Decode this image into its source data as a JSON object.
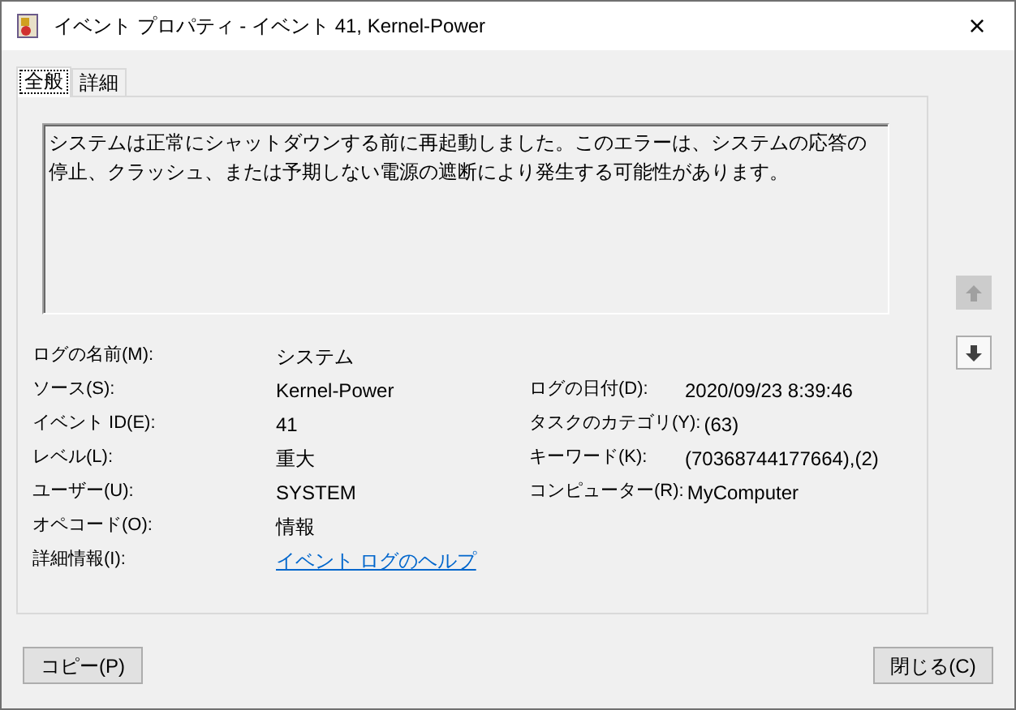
{
  "window": {
    "title": "イベント プロパティ - イベント 41, Kernel-Power",
    "close": "×"
  },
  "tabs": [
    {
      "label": "全般",
      "selected": true
    },
    {
      "label": "詳細",
      "selected": false
    }
  ],
  "description": "システムは正常にシャットダウンする前に再起動しました。このエラーは、システムの応答の停止、クラッシュ、または予期しない電源の遮断により発生する可能性があります。",
  "nav_buttons": [
    {
      "kind": "up",
      "disabled": true
    },
    {
      "kind": "down",
      "disabled": false
    }
  ],
  "fields_left": [
    {
      "label": "ログの名前(M):",
      "value": "システム"
    },
    {
      "label": "ソース(S):",
      "value": "Kernel-Power"
    },
    {
      "label": "イベント ID(E):",
      "value": "41"
    },
    {
      "label": "レベル(L):",
      "value": "重大"
    },
    {
      "label": "ユーザー(U):",
      "value": "SYSTEM"
    },
    {
      "label": "オペコード(O):",
      "value": "情報"
    },
    {
      "label": "詳細情報(I):",
      "value": "イベント ログのヘルプ",
      "kind": "link"
    }
  ],
  "fields_right": [
    {
      "label": "ログの日付(D):",
      "value": "2020/09/23 8:39:46"
    },
    {
      "label": "タスクのカテゴリ(Y):",
      "value": "(63)"
    },
    {
      "label": "キーワード(K):",
      "value": "(70368744177664),(2)"
    },
    {
      "label": "コンピューター(R):",
      "value": "MyComputer"
    }
  ],
  "buttons": [
    "コピー(P)",
    "閉じる(C)"
  ]
}
